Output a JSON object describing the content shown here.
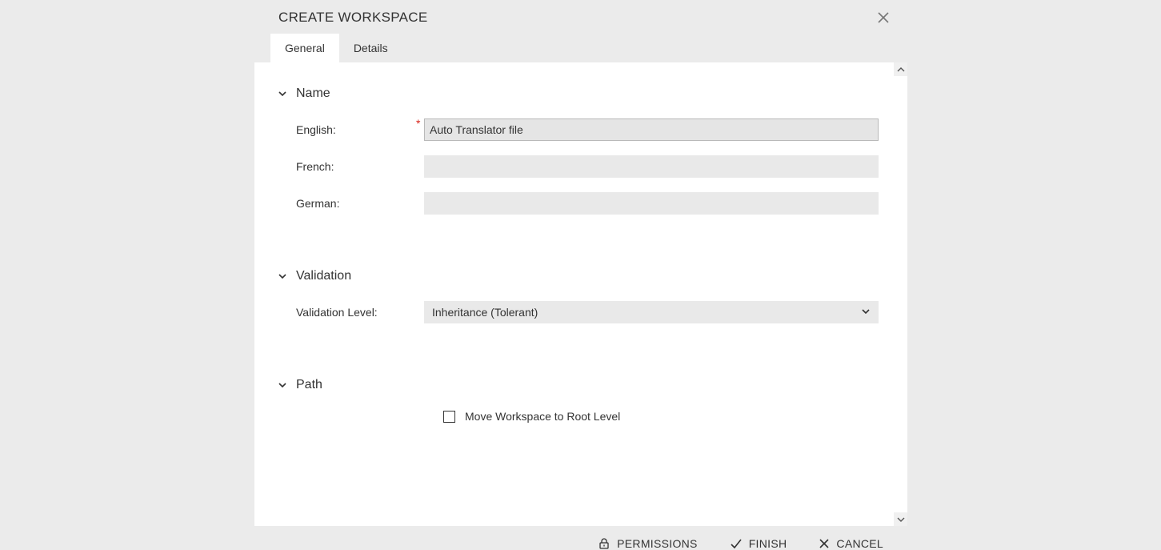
{
  "dialog": {
    "title": "CREATE WORKSPACE"
  },
  "tabs": {
    "general": "General",
    "details": "Details"
  },
  "sections": {
    "name": {
      "title": "Name",
      "english_label": "English:",
      "english_value": "Auto Translator file",
      "french_label": "French:",
      "french_value": "",
      "german_label": "German:",
      "german_value": ""
    },
    "validation": {
      "title": "Validation",
      "level_label": "Validation Level:",
      "level_value": "Inheritance (Tolerant)"
    },
    "path": {
      "title": "Path",
      "move_root_label": "Move Workspace to Root Level"
    }
  },
  "footer": {
    "permissions": "PERMISSIONS",
    "finish": "FINISH",
    "cancel": "CANCEL"
  }
}
